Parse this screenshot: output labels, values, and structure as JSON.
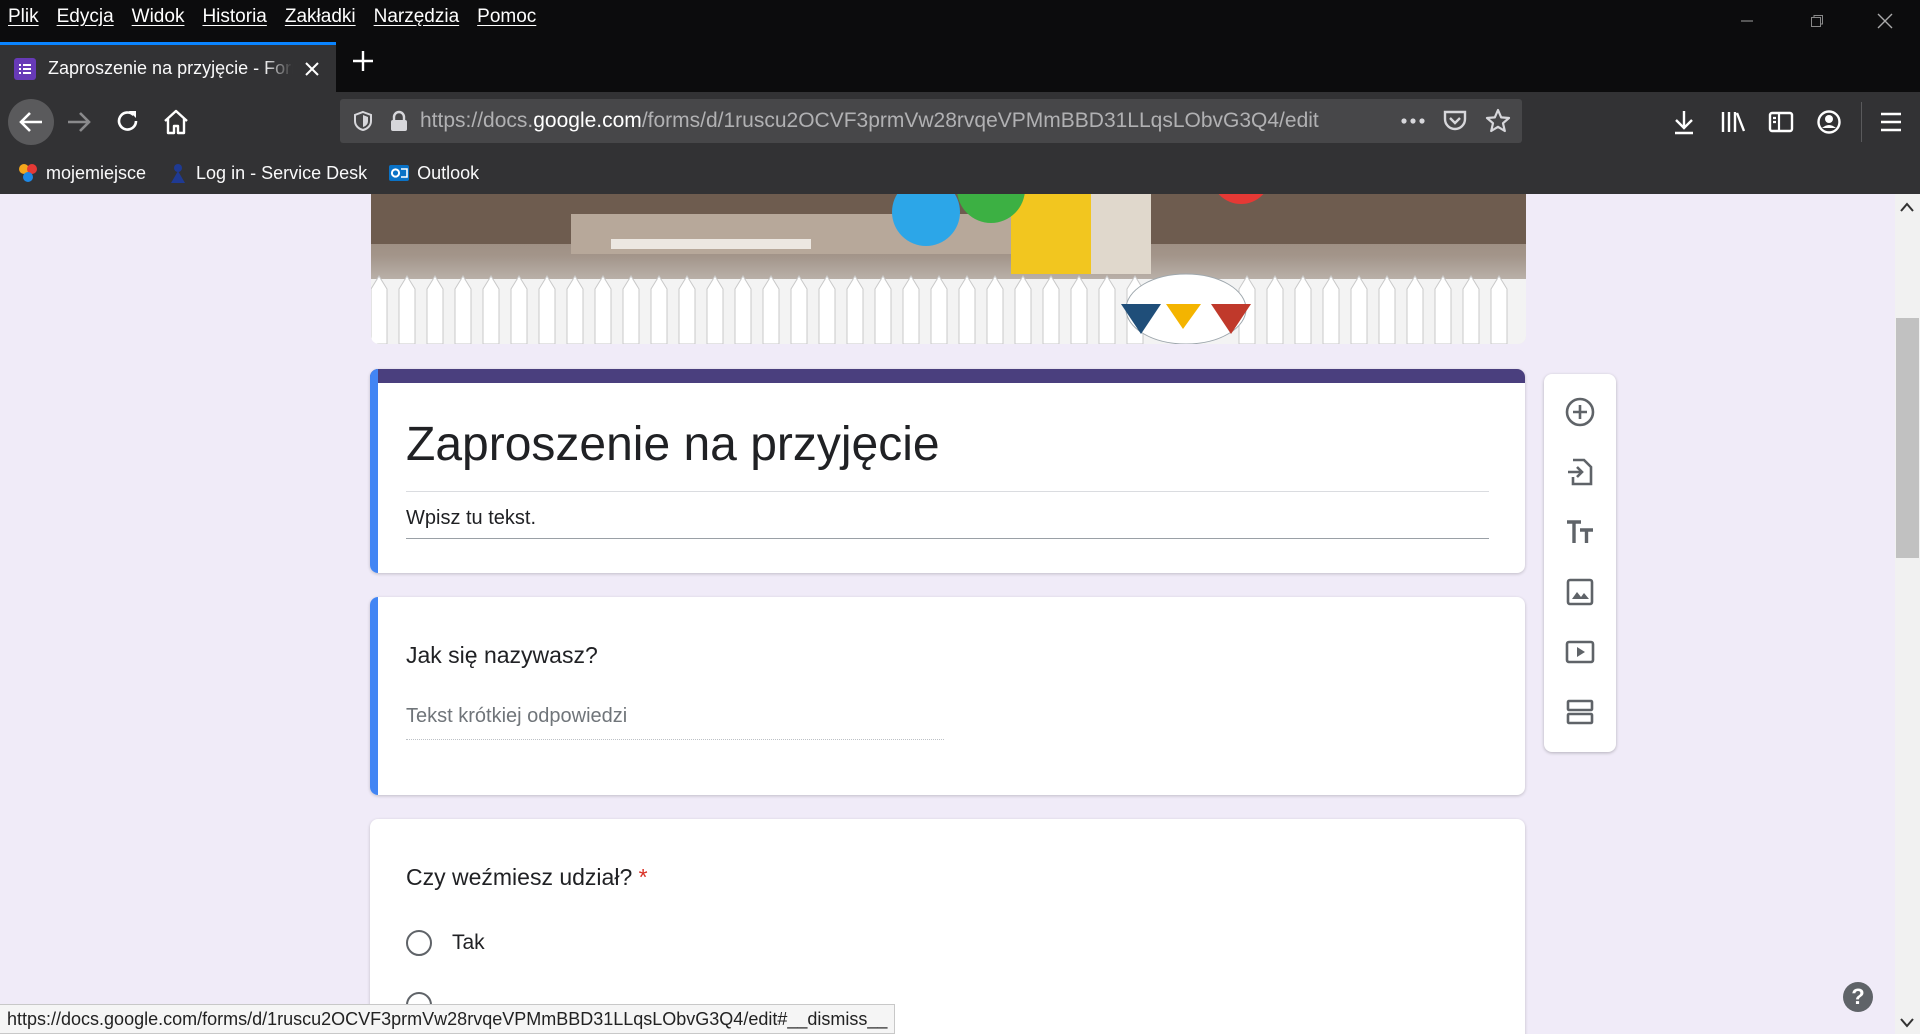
{
  "menubar": {
    "items": [
      "Plik",
      "Edycja",
      "Widok",
      "Historia",
      "Zakładki",
      "Narzędzia",
      "Pomoc"
    ]
  },
  "tab": {
    "title": "Zaproszenie na przyjęcie - Formularze Google",
    "favicon": "forms-icon"
  },
  "urlbar": {
    "prefix": "https://docs.",
    "host": "google.com",
    "path": "/forms/d/1ruscu2OCVF3prmVw28rvqeVPMmBBD31LLqsLObvG3Q4/edit"
  },
  "bookmarks": [
    {
      "label": "mojemiejsce",
      "icon": "mojemiejsce-icon"
    },
    {
      "label": "Log in - Service Desk",
      "icon": "service-desk-icon"
    },
    {
      "label": "Outlook",
      "icon": "outlook-icon"
    }
  ],
  "form": {
    "title": "Zaproszenie na przyjęcie",
    "description": "Wpisz tu tekst.",
    "theme_color": "#4a3f7e",
    "active_color": "#4285f4",
    "questions": [
      {
        "title": "Jak się nazywasz?",
        "placeholder": "Tekst krótkiej odpowiedzi"
      },
      {
        "title": "Czy weźmiesz udział?",
        "required_mark": "*",
        "options": [
          "Tak"
        ]
      }
    ]
  },
  "side_toolbar": [
    "add-question-icon",
    "import-questions-icon",
    "add-title-icon",
    "add-image-icon",
    "add-video-icon",
    "add-section-icon"
  ],
  "status_url": "https://docs.google.com/forms/d/1ruscu2OCVF3prmVw28rvqeVPMmBBD31LLqsLObvG3Q4/edit#__dismiss__",
  "help": "?"
}
